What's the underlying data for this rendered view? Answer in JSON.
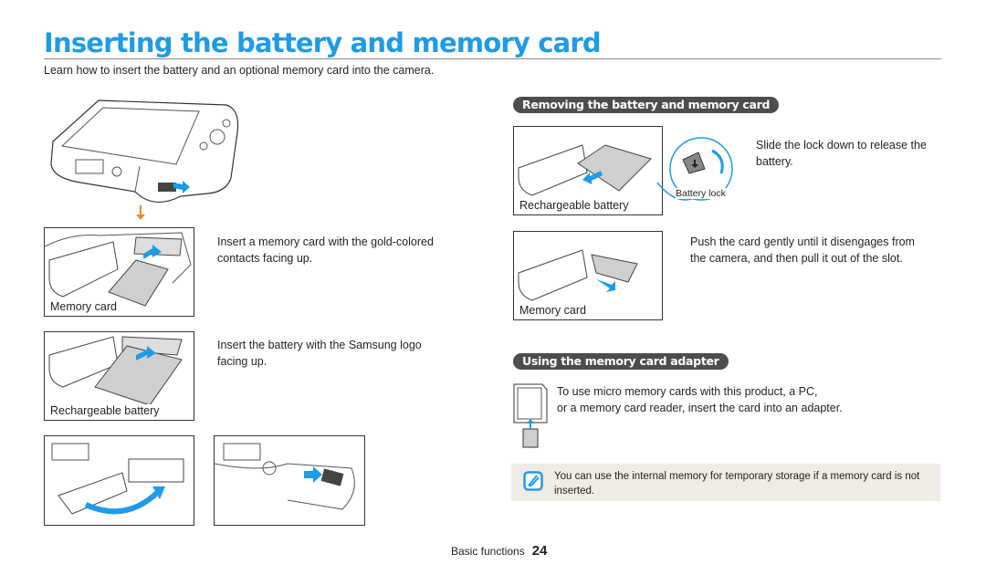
{
  "page": {
    "title": "Inserting the battery and memory card",
    "intro": "Learn how to insert the battery and an optional memory card into the camera."
  },
  "insert": {
    "steps": [
      {
        "caption": "Memory card",
        "text": "Insert a memory card with the gold-colored contacts facing up."
      },
      {
        "caption": "Rechargeable battery",
        "text": "Insert the battery with the Samsung logo facing up."
      }
    ]
  },
  "remove": {
    "heading": "Removing the battery and memory card",
    "battery": {
      "caption": "Rechargeable battery",
      "callout": "Battery lock",
      "text": "Slide the lock down to release the battery."
    },
    "card": {
      "caption": "Memory card",
      "text": "Push the card gently until it disengages from the camera, and then pull it out of the slot."
    }
  },
  "adapter": {
    "heading": "Using the memory card adapter",
    "text_line1": "To use micro memory cards with this product, a PC,",
    "text_line2": "or a memory card reader, insert the card into an adapter."
  },
  "note": {
    "icon": "note-pen-icon",
    "text": "You can use the internal memory for temporary storage if a memory card is not inserted."
  },
  "footer": {
    "section": "Basic functions",
    "page_number": "24"
  },
  "colors": {
    "title": "#1e9be8",
    "arrow_blue": "#1e9be8",
    "arrow_orange": "#f08a24",
    "pill": "#4d4d4d",
    "note_bg": "#efece6"
  }
}
